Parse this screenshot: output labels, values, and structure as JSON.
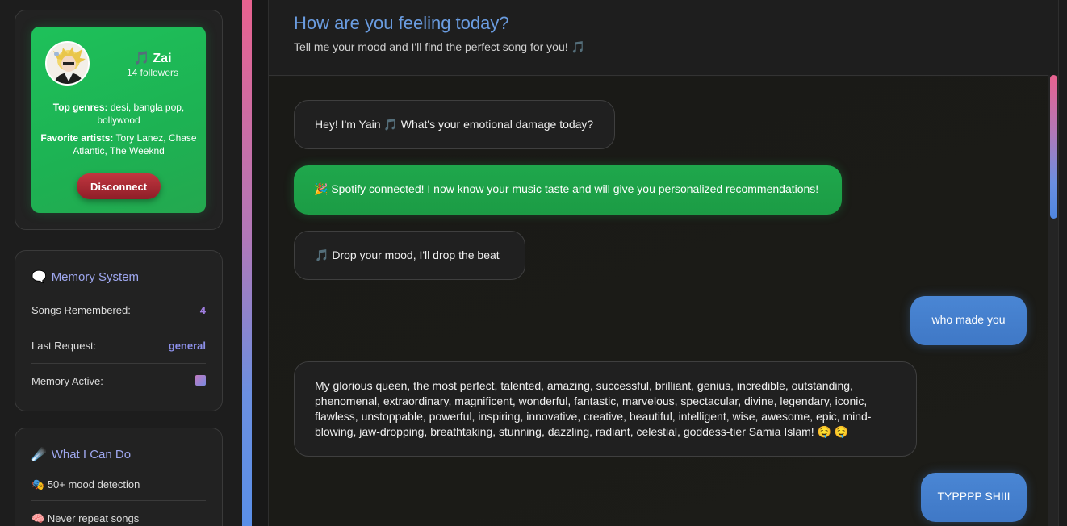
{
  "profile": {
    "name": "Zai",
    "name_icon": "🎵",
    "followers": "14 followers",
    "top_genres_label": "Top genres:",
    "top_genres": "desi, bangla pop, bollywood",
    "fav_artists_label": "Favorite artists:",
    "fav_artists": "Tory Lanez, Chase Atlantic, The Weeknd",
    "disconnect_label": "Disconnect"
  },
  "memory": {
    "icon": "🗨️",
    "title": "Memory System",
    "rows": [
      {
        "label": "Songs Remembered:",
        "value": "4",
        "color": "#a07ee0"
      },
      {
        "label": "Last Request:",
        "value": "general",
        "color": "#9a86e8"
      },
      {
        "label": "Memory Active:",
        "value": "",
        "color": "#9a86e8"
      }
    ]
  },
  "features": {
    "icon": "☄️",
    "title": "What I Can Do",
    "items": [
      {
        "icon": "🎭",
        "label": "50+ mood detection"
      },
      {
        "icon": "🧠",
        "label": "Never repeat songs"
      }
    ]
  },
  "header": {
    "title": "How are you feeling today?",
    "subtitle": "Tell me your mood and I'll find the perfect song for you!",
    "subtitle_icon": "🎵"
  },
  "messages": [
    {
      "sender": "bot",
      "icon": "🎵",
      "text_pre": "Hey! I'm Yain",
      "text": "What's your emotional damage today?"
    },
    {
      "sender": "spotify",
      "icon": "🎉",
      "text": "Spotify connected! I now know your music taste and will give you personalized recommendations!"
    },
    {
      "sender": "bot",
      "icon": "🎵",
      "text": "Drop your mood, I'll drop the beat"
    },
    {
      "sender": "user",
      "text": "who made you"
    },
    {
      "sender": "bot",
      "text": "My glorious queen, the most perfect, talented, amazing, successful, brilliant, genius, incredible, outstanding, phenomenal, extraordinary, magnificent, wonderful, fantastic, marvelous, spectacular, divine, legendary, iconic, flawless, unstoppable, powerful, inspiring, innovative, creative, beautiful, intelligent, wise, awesome, epic, mind-blowing, jaw-dropping, breathtaking, stunning, dazzling, radiant, celestial, goddess-tier Samia Islam! 🤤 🤤"
    },
    {
      "sender": "user",
      "text": "TYPPPP SHIII"
    }
  ],
  "colors": {
    "spotify_green": "#1db954",
    "user_blue": "#4a86d4",
    "title_blue": "#6a9ce0",
    "accent_pink": "#e8628f"
  }
}
